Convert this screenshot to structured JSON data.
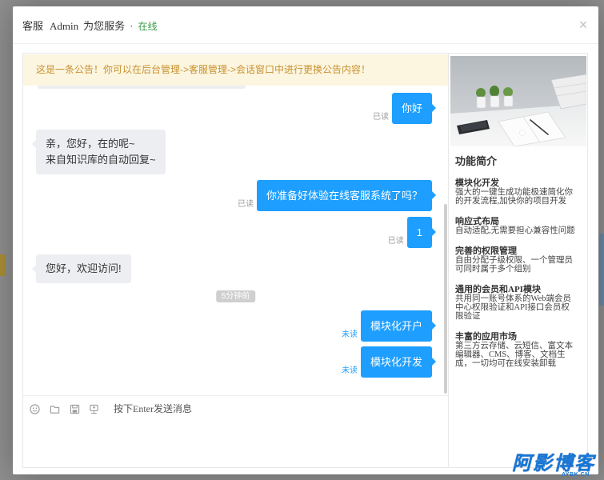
{
  "window": {
    "title_prefix": "客服",
    "agent_name": "Admin",
    "title_suffix": "为您服务",
    "separator": "·",
    "status": "在线",
    "close_label": "×"
  },
  "notice": {
    "text": "这是一条公告！你可以在后台管理->客服管理->会话窗口中进行更换公告内容！"
  },
  "chat": {
    "messages": [
      {
        "outgoing": true,
        "text": "你好",
        "read_status": "已读"
      },
      {
        "outgoing": false,
        "text": "亲，您好，在的呢~\n来自知识库的自动回复~"
      },
      {
        "outgoing": true,
        "text": "你准备好体验在线客服系统了吗？",
        "read_status": "已读"
      },
      {
        "outgoing": true,
        "text": "1",
        "read_status": "已读"
      },
      {
        "outgoing": false,
        "text": "您好，欢迎访问!"
      },
      {
        "outgoing": true,
        "text": "模块化开户",
        "read_status": "未读"
      },
      {
        "outgoing": true,
        "text": "模块化开发",
        "read_status": "未读"
      }
    ],
    "time_divider": "5分钟前"
  },
  "composer": {
    "placeholder": "按下Enter发送消息",
    "tools": [
      {
        "icon": "smiley-icon"
      },
      {
        "icon": "folder-icon"
      },
      {
        "icon": "save-icon"
      },
      {
        "icon": "monitor-icon"
      }
    ]
  },
  "sidebar": {
    "heading": "功能简介",
    "features": [
      {
        "title": "模块化开发",
        "desc": "强大的一键生成功能极速简化你的开发流程,加快你的项目开发"
      },
      {
        "title": "响应式布局",
        "desc": "自动适配,无需要担心兼容性问题"
      },
      {
        "title": "完善的权限管理",
        "desc": "自由分配子级权限、一个管理员可同时属于多个组别"
      },
      {
        "title": "通用的会员和API模块",
        "desc": "共用同一账号体系的Web端会员中心权限验证和API接口会员权限验证"
      },
      {
        "title": "丰富的应用市场",
        "desc": "第三方云存储、云短信、富文本编辑器、CMS、博客、文档生成，一切均可在线安装卸载"
      }
    ]
  },
  "watermark": {
    "main": "阿影博客",
    "sub": "AYBK.CN"
  },
  "colors": {
    "accent": "#1e9fff",
    "online": "#3a9a46",
    "notice_bg": "#fcf6e1",
    "notice_text": "#c9912f",
    "agent_bubble": "#eceef1",
    "read_status": "#9a9a9a",
    "time_pill": "#cfcfcf",
    "page_overlay": "#8f8f8f",
    "watermark": "#1677d8"
  }
}
